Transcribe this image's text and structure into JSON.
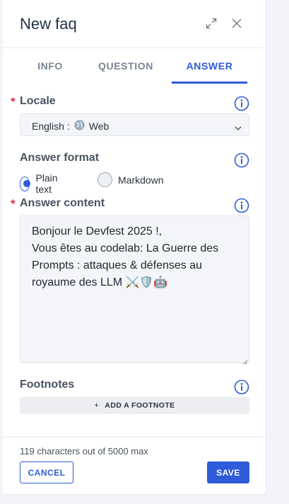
{
  "header": {
    "title": "New faq",
    "expand_icon": "expand-arrows-icon",
    "close_icon": "close-icon"
  },
  "tabs": [
    {
      "label": "INFO",
      "active": false
    },
    {
      "label": "QUESTION",
      "active": false
    },
    {
      "label": "ANSWER",
      "active": true
    }
  ],
  "locale": {
    "label": "Locale",
    "required": "*",
    "selected_language": "English :",
    "selected_channel": "Web",
    "channel_icon": "globe-icon"
  },
  "answer_format": {
    "label": "Answer format",
    "options": [
      {
        "label": "Plain text",
        "checked": true
      },
      {
        "label": "Markdown",
        "checked": false
      }
    ]
  },
  "answer_content": {
    "label": "Answer content",
    "required": "*",
    "value": "Bonjour le Devfest 2025 !,\nVous êtes au codelab: La Guerre des Prompts : attaques & défenses au royaume des LLM ⚔️🛡️🤖"
  },
  "footnotes": {
    "label": "Footnotes",
    "add_label": "ADD A FOOTNOTE"
  },
  "footer": {
    "char_count": "119 characters out of 5000 max",
    "cancel_label": "CANCEL",
    "save_label": "SAVE"
  },
  "colors": {
    "accent": "#2e5bd8",
    "required": "#d9304a",
    "background": "#f2f4f9"
  }
}
